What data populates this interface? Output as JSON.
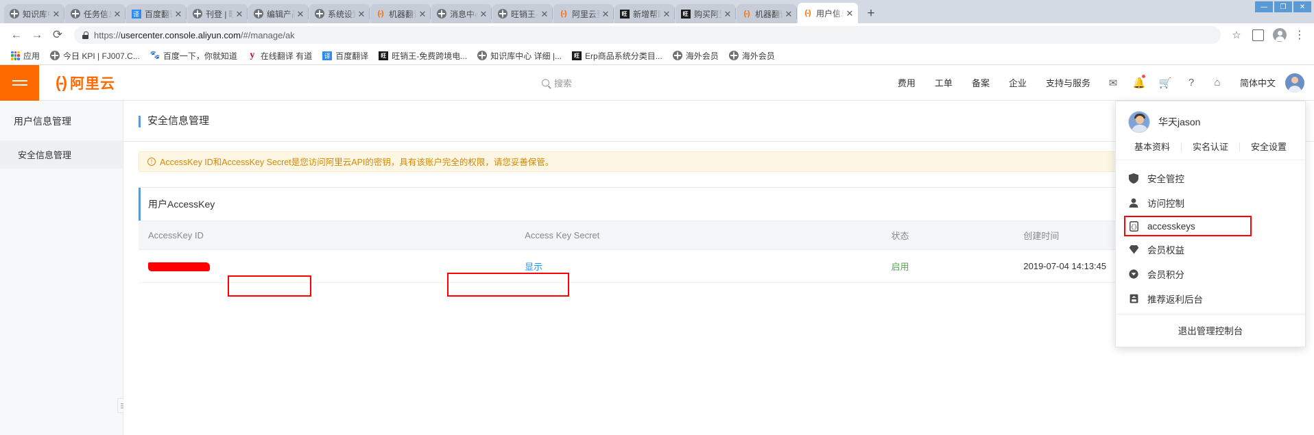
{
  "browser": {
    "tabs": [
      {
        "title": "知识库中心",
        "favicon": "globe-icon",
        "active": false
      },
      {
        "title": "任务信息列",
        "favicon": "globe-icon",
        "active": false
      },
      {
        "title": "百度翻译",
        "favicon": "translate-icon",
        "active": false
      },
      {
        "title": "刊登 | 旺销",
        "favicon": "globe-icon",
        "active": false
      },
      {
        "title": "编辑产品",
        "favicon": "globe-icon",
        "active": false
      },
      {
        "title": "系统设置",
        "favicon": "globe-icon",
        "active": false
      },
      {
        "title": "机器翻译",
        "favicon": "aliyun-icon",
        "active": false
      },
      {
        "title": "消息中心",
        "favicon": "globe-icon",
        "active": false
      },
      {
        "title": "旺销王-免费",
        "favicon": "globe-icon",
        "active": false
      },
      {
        "title": "阿里云登录",
        "favicon": "aliyun-icon",
        "active": false
      },
      {
        "title": "新增帮助",
        "favicon": "wangxiao-icon",
        "active": false
      },
      {
        "title": "购买阿里云",
        "favicon": "wangxiao-icon",
        "active": false
      },
      {
        "title": "机器翻译",
        "favicon": "aliyun-icon",
        "active": false
      },
      {
        "title": "用户信息管",
        "favicon": "aliyun-icon",
        "active": true
      }
    ],
    "new_tab_label": "+",
    "close_label": "✕",
    "window_controls": {
      "minimize": "—",
      "maximize": "❐",
      "close": "✕"
    },
    "nav": {
      "back": "←",
      "forward": "→",
      "reload": "⟳"
    },
    "url": {
      "scheme": "https://",
      "host": "usercenter.console.aliyun.com",
      "path": "/#/manage/ak"
    },
    "star_label": "☆",
    "menu_label": "⋮",
    "bookmarks": [
      {
        "label": "应用",
        "favicon": "apps-grid-icon"
      },
      {
        "label": "今日 KPI | FJ007.C...",
        "favicon": "globe-icon"
      },
      {
        "label": "百度一下，你就知道",
        "favicon": "baidu-icon"
      },
      {
        "label": "在线翻译 有道",
        "favicon": "youdao-icon"
      },
      {
        "label": "百度翻译",
        "favicon": "translate-icon"
      },
      {
        "label": "旺销王-免费跨境电...",
        "favicon": "wangxiao-icon"
      },
      {
        "label": "知识库中心 详细 |...",
        "favicon": "globe-icon"
      },
      {
        "label": "Erp商品系统分类目...",
        "favicon": "wangxiao-icon"
      },
      {
        "label": "海外会员",
        "favicon": "globe-icon"
      },
      {
        "label": "海外会员",
        "favicon": "globe-icon"
      }
    ]
  },
  "aliyun_header": {
    "menu_icon": "hamburger-icon",
    "logo_mark": "(-)",
    "logo_text": "阿里云",
    "search_placeholder": "搜索",
    "links": [
      "费用",
      "工单",
      "备案",
      "企业",
      "支持与服务"
    ],
    "icons": [
      "mail-icon",
      "bell-icon",
      "cart-icon",
      "help-icon",
      "home-icon"
    ],
    "language": "简体中文"
  },
  "sidebar": {
    "title": "用户信息管理",
    "items": [
      {
        "label": "安全信息管理",
        "active": true
      }
    ],
    "collapse_handle": "collapse-handle-icon"
  },
  "content": {
    "breadcrumb": "安全信息管理",
    "alert": {
      "icon": "warning-icon",
      "text": "AccessKey ID和AccessKey Secret是您访问阿里云API的密钥，具有该账户完全的权限，请您妥善保管。"
    },
    "panel_title": "用户AccessKey",
    "table": {
      "columns": [
        "AccessKey ID",
        "Access Key Secret",
        "状态",
        "创建时间"
      ],
      "rows": [
        {
          "access_key_id": "",
          "access_key_id_redacted": true,
          "secret_action": "显示",
          "status": "启用",
          "created_at": "2019-07-04 14:13:45"
        }
      ]
    }
  },
  "user_dropdown": {
    "username": "华天jason",
    "avatar": "user-avatar",
    "quick_links": [
      "基本资料",
      "实名认证",
      "安全设置"
    ],
    "items": [
      {
        "label": "安全管控",
        "icon": "shield-icon",
        "highlighted": false
      },
      {
        "label": "访问控制",
        "icon": "person-icon",
        "highlighted": false
      },
      {
        "label": "accesskeys",
        "icon": "key-icon",
        "highlighted": true
      },
      {
        "label": "会员权益",
        "icon": "heart-icon",
        "highlighted": false
      },
      {
        "label": "会员积分",
        "icon": "coin-icon",
        "highlighted": false
      },
      {
        "label": "推荐返利后台",
        "icon": "rebate-icon",
        "highlighted": false
      }
    ],
    "logout": "退出管理控制台"
  },
  "colors": {
    "brand_orange": "#ff6a00",
    "annotation_red": "#ff0000",
    "link_blue": "#1890ff",
    "status_green": "#52a64d",
    "alert_bg": "#fdf6e3",
    "alert_text": "#d48806"
  }
}
